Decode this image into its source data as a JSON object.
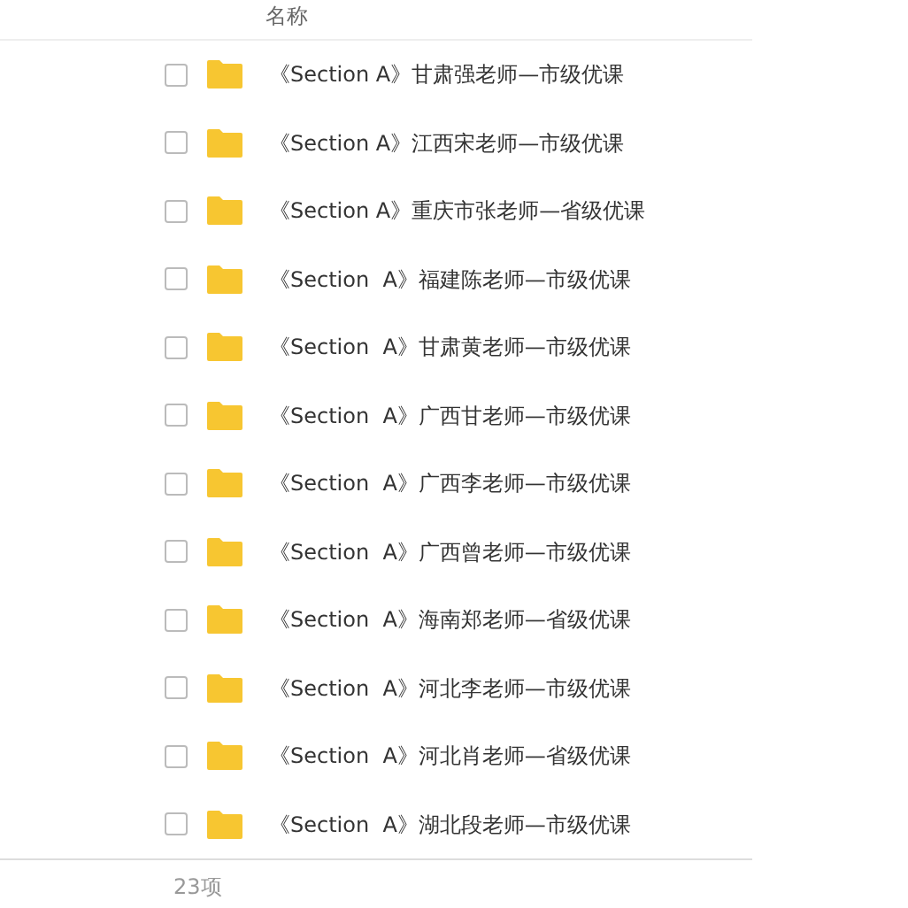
{
  "table": {
    "columns": [
      "名称"
    ],
    "rows": [
      {
        "name": "《Section A》甘肃强老师—市级优课",
        "checked": false
      },
      {
        "name": "《Section A》江西宋老师—市级优课",
        "checked": false
      },
      {
        "name": "《Section A》重庆市张老师—省级优课",
        "checked": false
      },
      {
        "name": "《Section  A》福建陈老师—市级优课",
        "checked": false
      },
      {
        "name": "《Section  A》甘肃黄老师—市级优课",
        "checked": false
      },
      {
        "name": "《Section  A》广西甘老师—市级优课",
        "checked": false
      },
      {
        "name": "《Section  A》广西李老师—市级优课",
        "checked": false
      },
      {
        "name": "《Section  A》广西曾老师—市级优课",
        "checked": false
      },
      {
        "name": "《Section  A》海南郑老师—省级优课",
        "checked": false
      },
      {
        "name": "《Section  A》河北李老师—市级优课",
        "checked": false
      },
      {
        "name": "《Section  A》河北肖老师—省级优课",
        "checked": false
      },
      {
        "name": "《Section  A》湖北段老师—市级优课",
        "checked": false
      }
    ]
  },
  "status_bar": {
    "count": "23项"
  }
}
